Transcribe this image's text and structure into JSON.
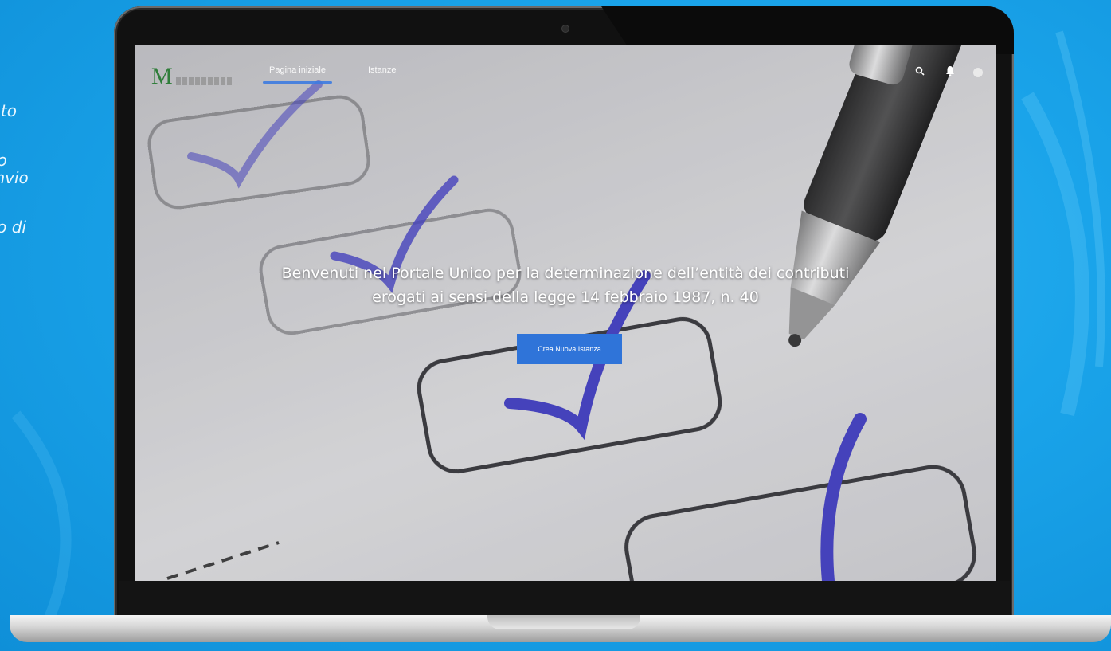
{
  "side_text": {
    "line1": "nato",
    "line2": "nto",
    "line3": "l’invio",
    "line4": "ato di"
  },
  "app": {
    "logo_mark": "M",
    "nav": {
      "tabs": [
        {
          "label": "Pagina iniziale",
          "active": true
        },
        {
          "label": "Istanze",
          "active": false
        }
      ]
    },
    "icons": [
      "search-icon",
      "bell-icon",
      "user-avatar-icon"
    ],
    "hero": {
      "line1": "Benvenuti nel Portale Unico per la determinazione dell’entità dei contributi",
      "line2": "erogati ai sensi della legge 14 febbraio 1987, n. 40"
    },
    "cta_label": "Crea Nuova Istanza"
  },
  "colors": {
    "background": "#1aa4ea",
    "accent": "#2f74d9",
    "checkmark": "#3a3ad0"
  }
}
